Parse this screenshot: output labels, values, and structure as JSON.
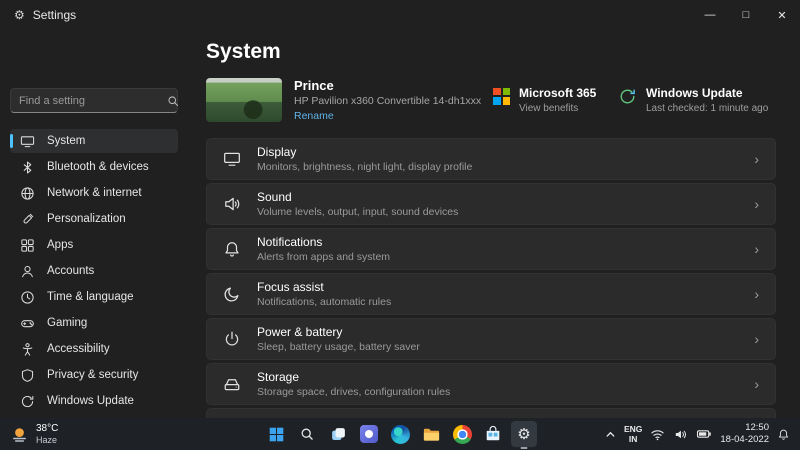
{
  "window": {
    "title": "Settings",
    "controls": {
      "minimize": "—",
      "maximize": "□",
      "close": "✕"
    }
  },
  "glyphs": {
    "gear": "⚙",
    "chevron_right": "›"
  },
  "sidebar": {
    "search": {
      "placeholder": "Find a setting"
    },
    "selected_index": 0,
    "items": [
      {
        "label": "System"
      },
      {
        "label": "Bluetooth & devices"
      },
      {
        "label": "Network & internet"
      },
      {
        "label": "Personalization"
      },
      {
        "label": "Apps"
      },
      {
        "label": "Accounts"
      },
      {
        "label": "Time & language"
      },
      {
        "label": "Gaming"
      },
      {
        "label": "Accessibility"
      },
      {
        "label": "Privacy & security"
      },
      {
        "label": "Windows Update"
      }
    ]
  },
  "main": {
    "page_title": "System",
    "device_card": {
      "name": "Prince",
      "model": "HP Pavilion x360 Convertible 14-dh1xxx",
      "rename_label": "Rename"
    },
    "microsoft365_card": {
      "title": "Microsoft 365",
      "subtitle": "View benefits"
    },
    "update_card": {
      "title": "Windows Update",
      "subtitle": "Last checked: 1 minute ago"
    },
    "settings_list": [
      {
        "label": "Display",
        "description": "Monitors, brightness, night light, display profile"
      },
      {
        "label": "Sound",
        "description": "Volume levels, output, input, sound devices"
      },
      {
        "label": "Notifications",
        "description": "Alerts from apps and system"
      },
      {
        "label": "Focus assist",
        "description": "Notifications, automatic rules"
      },
      {
        "label": "Power & battery",
        "description": "Sleep, battery usage, battery saver"
      },
      {
        "label": "Storage",
        "description": "Storage space, drives, configuration rules"
      }
    ]
  },
  "taskbar": {
    "weather": {
      "temperature": "38°C",
      "condition": "Haze"
    },
    "apps": [
      "start",
      "search",
      "task-view",
      "chat",
      "edge",
      "file-explorer",
      "chrome",
      "store",
      "settings"
    ],
    "tray": {
      "language": "ENG",
      "region": "IN",
      "time": "12:50",
      "date": "18-04-2022"
    }
  },
  "colors": {
    "accent": "#4cc2ff",
    "link": "#5fb2e8",
    "card_background": "#2b2b2b",
    "taskbar_background": "#1e2126",
    "ms_red": "#f25022",
    "ms_green": "#7fba00",
    "ms_blue": "#00a4ef",
    "ms_yellow": "#ffb900"
  }
}
